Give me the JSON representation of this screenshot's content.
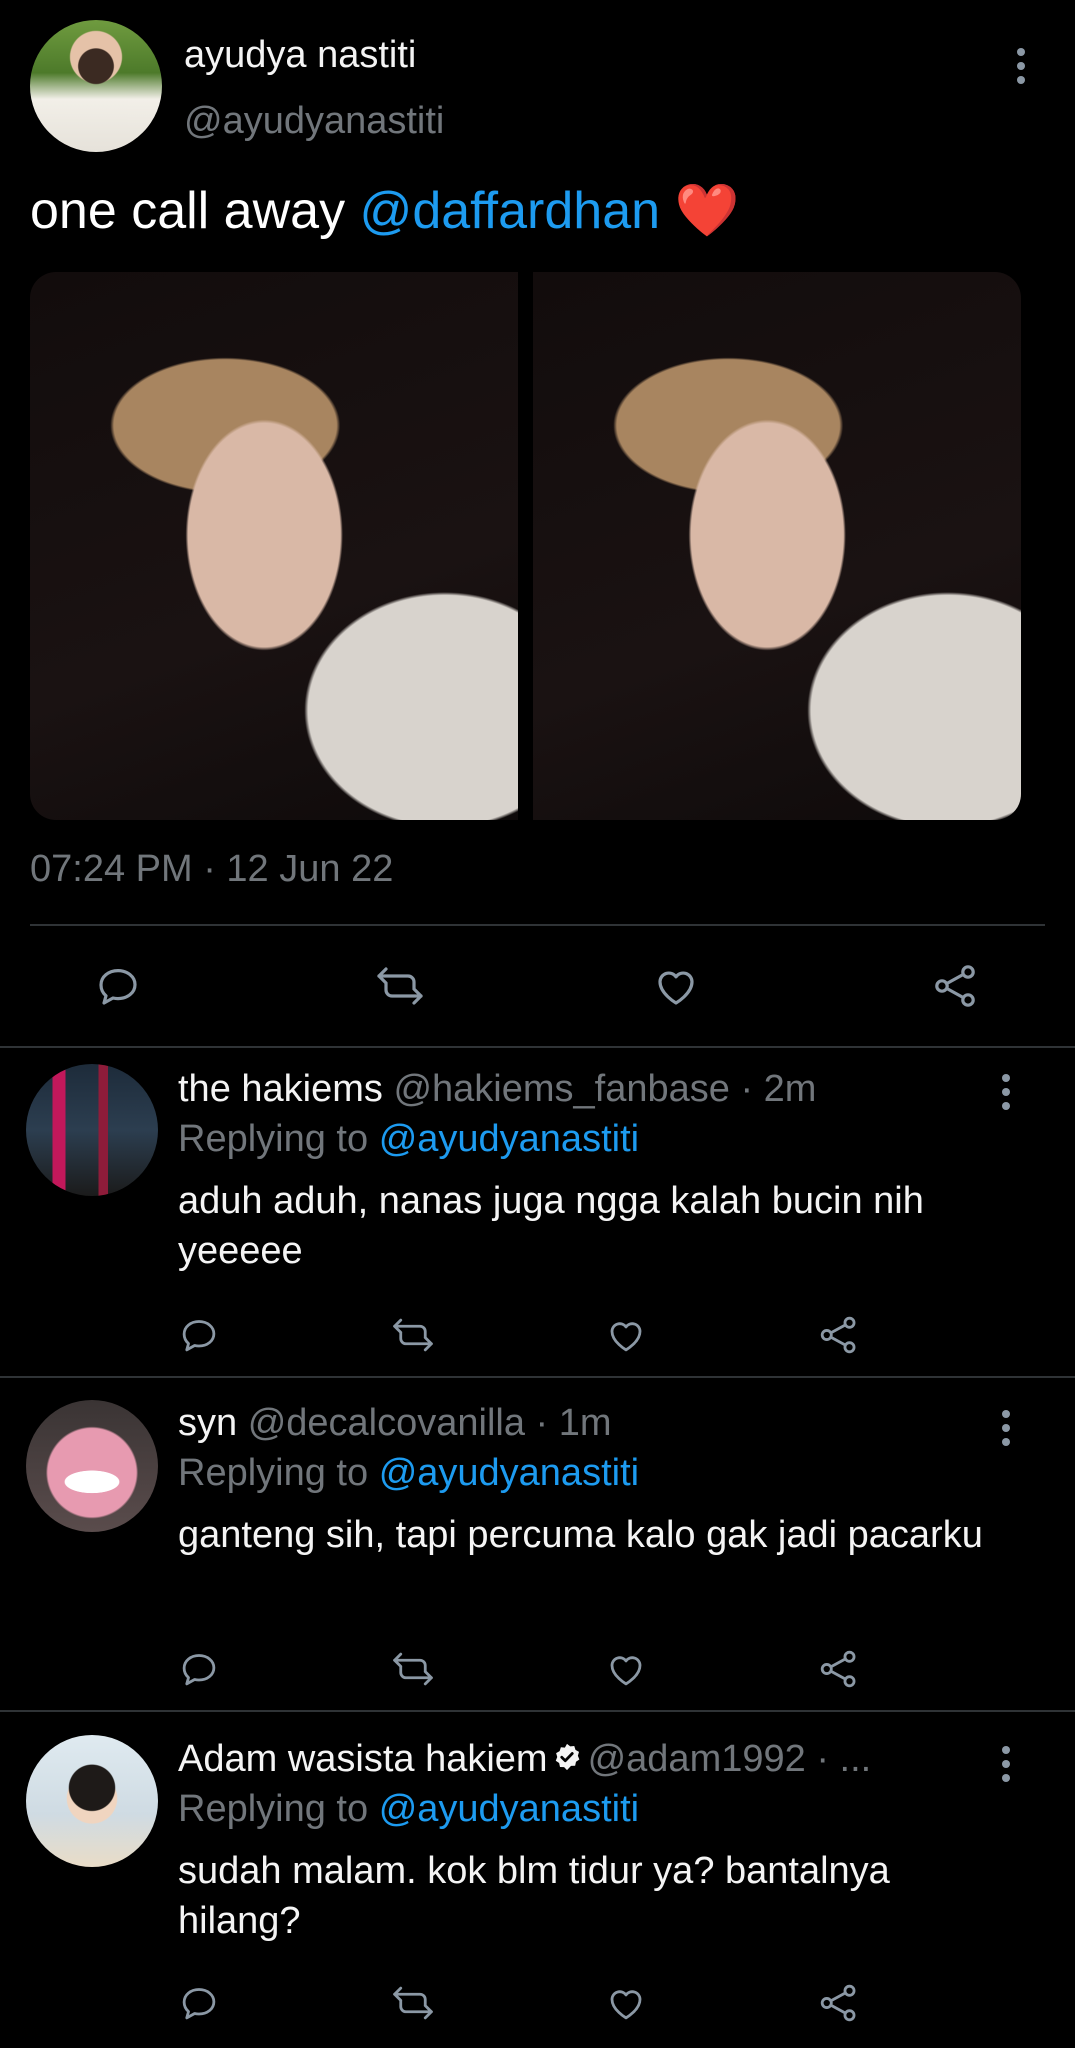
{
  "tweet": {
    "author_name": "ayudya nastiti",
    "author_handle": "@ayudyanastiti",
    "text": "one call away",
    "mention": "@daffardhan",
    "emoji": "❤️",
    "timestamp": "07:24 PM · 12 Jun 22"
  },
  "replies": [
    {
      "name": "the hakiems",
      "meta": "@hakiems_fanbase · 2m",
      "replying_label": "Replying to",
      "replying_to": "@ayudyanastiti",
      "text": "aduh aduh, nanas juga ngga kalah bucin nih yeeeee"
    },
    {
      "name": "syn",
      "meta": "@decalcovanilla · 1m",
      "replying_label": "Replying to",
      "replying_to": "@ayudyanastiti",
      "text": "ganteng sih, tapi percuma kalo gak jadi pacarku"
    },
    {
      "name": "Adam wasista hakiem",
      "meta": "@adam1992 · ...",
      "replying_label": "Replying to",
      "replying_to": "@ayudyanastiti",
      "text": "sudah malam. kok blm tidur ya? bantalnya hilang?"
    }
  ],
  "icons": {
    "reply": "speech-bubble-icon",
    "retweet": "retweet-icon",
    "like": "heart-icon",
    "share": "share-icon",
    "more": "vertical-dots-icon",
    "verified": "verified-badge-icon"
  },
  "colors": {
    "background": "#000000",
    "accent": "#1d9bf0",
    "muted": "#71767b",
    "divider": "#2f3336"
  }
}
